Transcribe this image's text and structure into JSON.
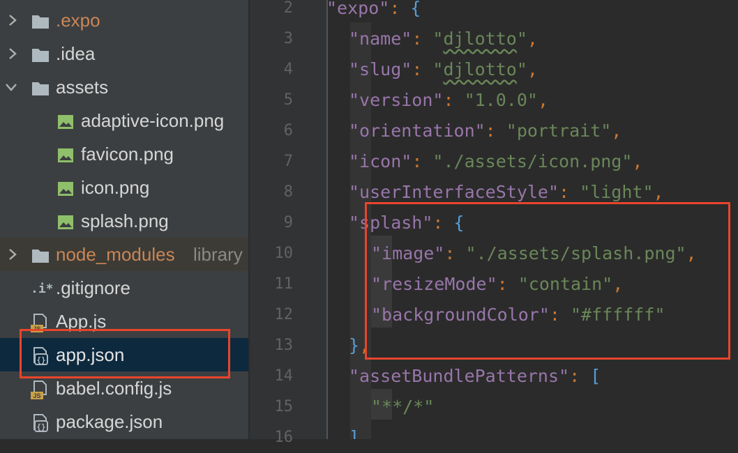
{
  "colors": {
    "highlight": "#e8452c",
    "selection": "#0d293e",
    "string": "#6a8759",
    "key": "#9876aa"
  },
  "project_tree": {
    "items": [
      {
        "label": ".expo",
        "type": "folder",
        "expanded": false,
        "icon": "folder-icon"
      },
      {
        "label": ".idea",
        "type": "folder",
        "expanded": false,
        "icon": "folder-icon"
      },
      {
        "label": "assets",
        "type": "folder",
        "expanded": true,
        "icon": "folder-icon"
      },
      {
        "label": "adaptive-icon.png",
        "type": "image",
        "icon": "image-file-icon"
      },
      {
        "label": "favicon.png",
        "type": "image",
        "icon": "image-file-icon"
      },
      {
        "label": "icon.png",
        "type": "image",
        "icon": "image-file-icon"
      },
      {
        "label": "splash.png",
        "type": "image",
        "icon": "image-file-icon"
      },
      {
        "label": "node_modules",
        "suffix": "library",
        "type": "folder",
        "expanded": false,
        "icon": "folder-icon"
      },
      {
        "label": ".gitignore",
        "type": "file",
        "icon": "ignore-file-icon",
        "icon_text": ".i*"
      },
      {
        "label": "App.js",
        "type": "js",
        "icon": "js-file-icon",
        "icon_text": "JS"
      },
      {
        "label": "app.json",
        "type": "json",
        "icon": "json-file-icon",
        "icon_text": "{}",
        "selected": true
      },
      {
        "label": "babel.config.js",
        "type": "js",
        "icon": "js-file-icon",
        "icon_text": "JS"
      },
      {
        "label": "package.json",
        "type": "json",
        "icon": "json-file-icon",
        "icon_text": "{}"
      }
    ]
  },
  "editor": {
    "line_numbers": [
      "2",
      "3",
      "4",
      "5",
      "6",
      "7",
      "8",
      "9",
      "10",
      "11",
      "12",
      "13",
      "14",
      "15",
      "16"
    ],
    "lines": [
      {
        "n": "2",
        "tokens": [
          [
            "k",
            "\"expo\""
          ],
          [
            "p",
            ": "
          ],
          [
            "brace",
            "{"
          ]
        ]
      },
      {
        "n": "3",
        "tokens": [
          [
            "k",
            "\"name\""
          ],
          [
            "p",
            ": "
          ],
          [
            "s",
            "\""
          ],
          [
            "sw",
            "djlotto"
          ],
          [
            "s",
            "\""
          ],
          [
            "p",
            ","
          ]
        ]
      },
      {
        "n": "4",
        "tokens": [
          [
            "k",
            "\"slug\""
          ],
          [
            "p",
            ": "
          ],
          [
            "s",
            "\""
          ],
          [
            "sw",
            "djlotto"
          ],
          [
            "s",
            "\""
          ],
          [
            "p",
            ","
          ]
        ]
      },
      {
        "n": "5",
        "tokens": [
          [
            "k",
            "\"version\""
          ],
          [
            "p",
            ": "
          ],
          [
            "s",
            "\"1.0.0\""
          ],
          [
            "p",
            ","
          ]
        ]
      },
      {
        "n": "6",
        "tokens": [
          [
            "k",
            "\"orientation\""
          ],
          [
            "p",
            ": "
          ],
          [
            "s",
            "\"portrait\""
          ],
          [
            "p",
            ","
          ]
        ]
      },
      {
        "n": "7",
        "tokens": [
          [
            "k",
            "\"icon\""
          ],
          [
            "p",
            ": "
          ],
          [
            "s",
            "\"./assets/icon.png\""
          ],
          [
            "p",
            ","
          ]
        ]
      },
      {
        "n": "8",
        "tokens": [
          [
            "k",
            "\"userInterfaceStyle\""
          ],
          [
            "p",
            ": "
          ],
          [
            "s",
            "\"light\""
          ],
          [
            "p",
            ","
          ]
        ]
      },
      {
        "n": "9",
        "tokens": [
          [
            "k",
            "\"splash\""
          ],
          [
            "p",
            ": "
          ],
          [
            "brace",
            "{"
          ]
        ]
      },
      {
        "n": "10",
        "tokens": [
          [
            "k",
            "\"image\""
          ],
          [
            "p",
            ": "
          ],
          [
            "s",
            "\"./assets/splash.png\""
          ],
          [
            "p",
            ","
          ]
        ]
      },
      {
        "n": "11",
        "tokens": [
          [
            "k",
            "\"resizeMode\""
          ],
          [
            "p",
            ": "
          ],
          [
            "s",
            "\"contain\""
          ],
          [
            "p",
            ","
          ]
        ]
      },
      {
        "n": "12",
        "tokens": [
          [
            "k",
            "\"backgroundColor\""
          ],
          [
            "p",
            ": "
          ],
          [
            "s",
            "\"#ffffff\""
          ]
        ]
      },
      {
        "n": "13",
        "tokens": [
          [
            "brace",
            "}"
          ],
          [
            "p",
            ","
          ]
        ]
      },
      {
        "n": "14",
        "tokens": [
          [
            "k",
            "\"assetBundlePatterns\""
          ],
          [
            "p",
            ": "
          ],
          [
            "brace",
            "["
          ]
        ]
      },
      {
        "n": "15",
        "tokens": [
          [
            "s",
            "\"**/*\""
          ]
        ]
      },
      {
        "n": "16",
        "tokens": [
          [
            "brace",
            "]"
          ]
        ]
      }
    ]
  }
}
